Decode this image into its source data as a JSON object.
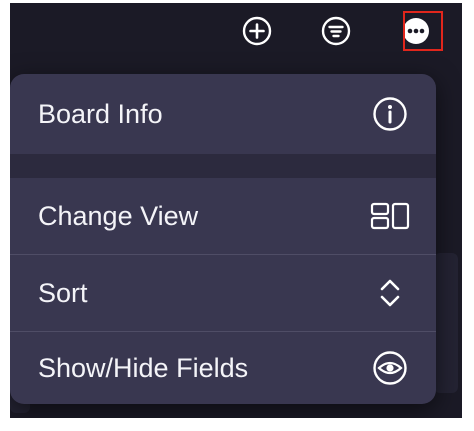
{
  "toolbar": {
    "icons": [
      "add-circle-icon",
      "filter-list-icon",
      "more-options-icon"
    ]
  },
  "menu": {
    "items": [
      {
        "label": "Board Info",
        "icon": "info-icon"
      },
      {
        "label": "Change View",
        "icon": "layout-view-icon"
      },
      {
        "label": "Sort",
        "icon": "sort-chevrons-icon"
      },
      {
        "label": "Show/Hide Fields",
        "icon": "eye-icon"
      }
    ]
  },
  "colors": {
    "background": "#1b1a26",
    "menu": "#393750",
    "text": "#f4f4f8",
    "highlight": "#e1261c"
  }
}
